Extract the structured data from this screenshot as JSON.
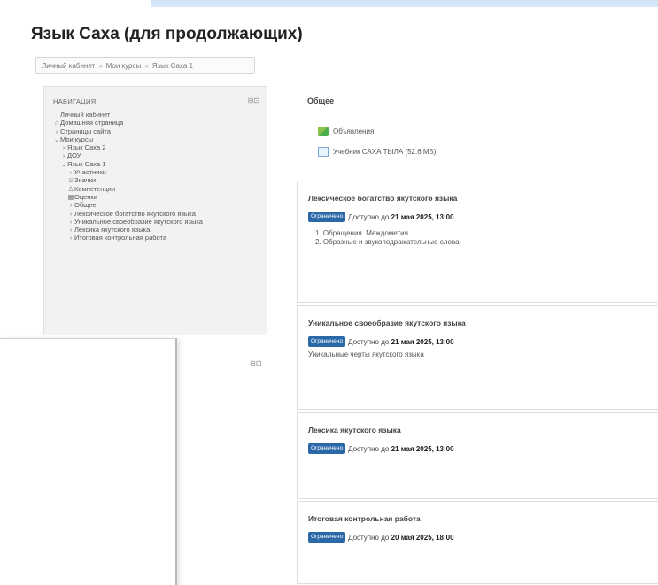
{
  "page_title": "Язык Саха (для продолжающих)",
  "breadcrumb": [
    "Личный кабинет",
    "Мои курсы",
    "Язык Саха 1"
  ],
  "breadcrumb_sep": "»",
  "navigation": {
    "title": "НАВИГАЦИЯ",
    "control_icons": "⊟⊡",
    "items": [
      {
        "glyph": "",
        "label": "Личный кабинет",
        "indent": 0
      },
      {
        "glyph": "⌂",
        "label": "Домашняя страница",
        "indent": 0
      },
      {
        "glyph": "›",
        "label": "Страницы сайта",
        "indent": 0
      },
      {
        "glyph": "⌄",
        "label": "Мои курсы",
        "indent": 0
      },
      {
        "glyph": "›",
        "label": "Язык Саха 2",
        "indent": 1
      },
      {
        "glyph": "›",
        "label": "ДОУ",
        "indent": 1
      },
      {
        "glyph": "⌄",
        "label": "Язык Саха 1",
        "indent": 1
      },
      {
        "glyph": "›",
        "label": "Участники",
        "indent": 2
      },
      {
        "glyph": "♕",
        "label": "Значки",
        "indent": 2
      },
      {
        "glyph": "♙",
        "label": "Компетенции",
        "indent": 2
      },
      {
        "glyph": "▦",
        "label": "Оценки",
        "indent": 2
      },
      {
        "glyph": "›",
        "label": "Общее",
        "indent": 2
      },
      {
        "glyph": "›",
        "label": "Лексическое богатство якутского языка",
        "indent": 2
      },
      {
        "glyph": "›",
        "label": "Уникальное своеобразие якутского языка",
        "indent": 2
      },
      {
        "glyph": "›",
        "label": "Лексика якутского языка",
        "indent": 2
      },
      {
        "glyph": "›",
        "label": "Итоговая контрольная работа",
        "indent": 2
      }
    ]
  },
  "general": {
    "title": "Общее",
    "resources": [
      {
        "icon": "forum-icon",
        "label": "Объявления"
      },
      {
        "icon": "file-icon",
        "label": "Учебник САХА ТЫЛА (52.6 МБ)"
      }
    ]
  },
  "badge_label": "Ограничено",
  "sections": [
    {
      "title": "Лексическое богатство якутского языка",
      "avail_prefix": "Доступно до",
      "avail_date": "21 мая 2025, 13:00",
      "summary_list": [
        "1. Обращения. Междометия",
        "2. Образные и звукоподражательные слова"
      ],
      "summary": ""
    },
    {
      "title": "Уникальное своеобразие якутского языка",
      "avail_prefix": "Доступно до",
      "avail_date": "21 мая 2025, 13:00",
      "summary_list": [],
      "summary": "Уникальные черты якутского языка"
    },
    {
      "title": "Лексика якутского языка",
      "avail_prefix": "Доступно до",
      "avail_date": "21 мая 2025, 13:00",
      "summary_list": [],
      "summary": ""
    },
    {
      "title": "Итоговая контрольная работа",
      "avail_prefix": "Доступно до",
      "avail_date": "20 мая 2025, 18:00",
      "summary_list": [],
      "summary": ""
    }
  ]
}
